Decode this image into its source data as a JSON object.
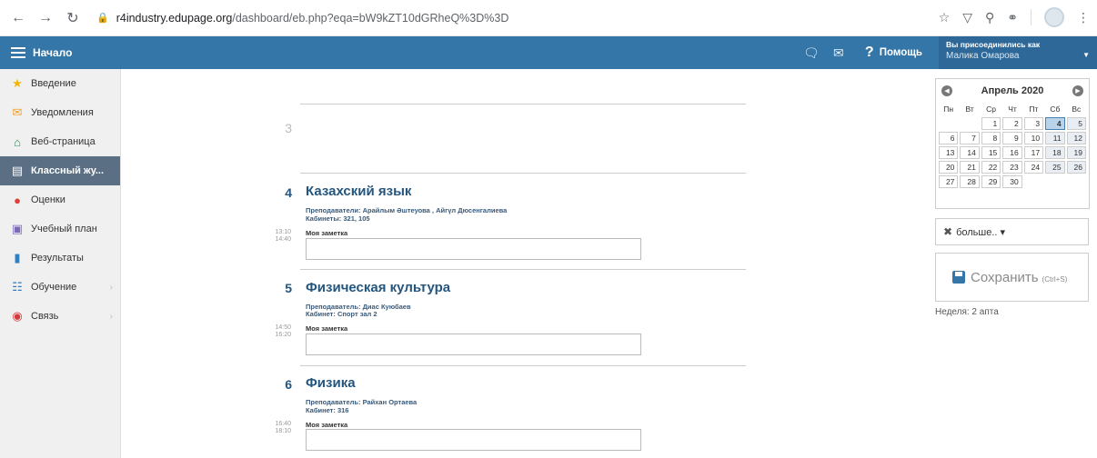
{
  "browser": {
    "url_host": "r4industry.edupage.org",
    "url_path": "/dashboard/eb.php?eqa=bW9kZT10dGRheQ%3D%3D"
  },
  "header": {
    "home_label": "Начало",
    "help_label": "Помощь",
    "user_line1": "Вы присоединились как",
    "user_name": "Малика Омарова"
  },
  "sidebar": {
    "items": [
      {
        "label": "Введение",
        "icon": "star-icon"
      },
      {
        "label": "Уведомления",
        "icon": "envelope-icon"
      },
      {
        "label": "Веб-страница",
        "icon": "house-icon"
      },
      {
        "label": "Классный жу...",
        "icon": "journal-icon"
      },
      {
        "label": "Оценки",
        "icon": "grades-icon"
      },
      {
        "label": "Учебный план",
        "icon": "plan-icon"
      },
      {
        "label": "Результаты",
        "icon": "chart-icon"
      },
      {
        "label": "Обучение",
        "icon": "book-icon"
      },
      {
        "label": "Связь",
        "icon": "chat-icon"
      }
    ]
  },
  "lessons": [
    {
      "num": "3"
    },
    {
      "num": "4",
      "title": "Казахский язык",
      "teacher_line": "Преподаватели:  Арайлым Әштеуова , Айгүл Дюсенгалиева",
      "room_line": "Кабинеты:  321, 105",
      "time_start": "13:10",
      "time_end": "14:40",
      "note_label": "Моя заметка"
    },
    {
      "num": "5",
      "title": "Физическая культура",
      "teacher_line": "Преподаватель:  Диас Куюбаев",
      "room_line": "Кабинет:  Спорт зал 2",
      "time_start": "14:50",
      "time_end": "16:20",
      "note_label": "Моя заметка"
    },
    {
      "num": "6",
      "title": "Физика",
      "teacher_line": "Преподаватель:  Райхан Ортаева",
      "room_line": "Кабинет:  316",
      "time_start": "16:40",
      "time_end": "18:10",
      "note_label": "Моя заметка"
    }
  ],
  "calendar": {
    "month": "Апрель 2020",
    "dows": [
      "Пн",
      "Вт",
      "Ср",
      "Чт",
      "Пт",
      "Сб",
      "Вс"
    ],
    "weeks": [
      [
        "",
        "",
        "1",
        "2",
        "3",
        "4",
        "5"
      ],
      [
        "6",
        "7",
        "8",
        "9",
        "10",
        "11",
        "12"
      ],
      [
        "13",
        "14",
        "15",
        "16",
        "17",
        "18",
        "19"
      ],
      [
        "20",
        "21",
        "22",
        "23",
        "24",
        "25",
        "26"
      ],
      [
        "27",
        "28",
        "29",
        "30",
        "",
        "",
        ""
      ]
    ],
    "selected": "4"
  },
  "right": {
    "more_label": "больше.. ▾",
    "save_label": "Сохранить",
    "save_shortcut": "(Ctrl+S)",
    "week_label": "Неделя: 2 апта"
  }
}
